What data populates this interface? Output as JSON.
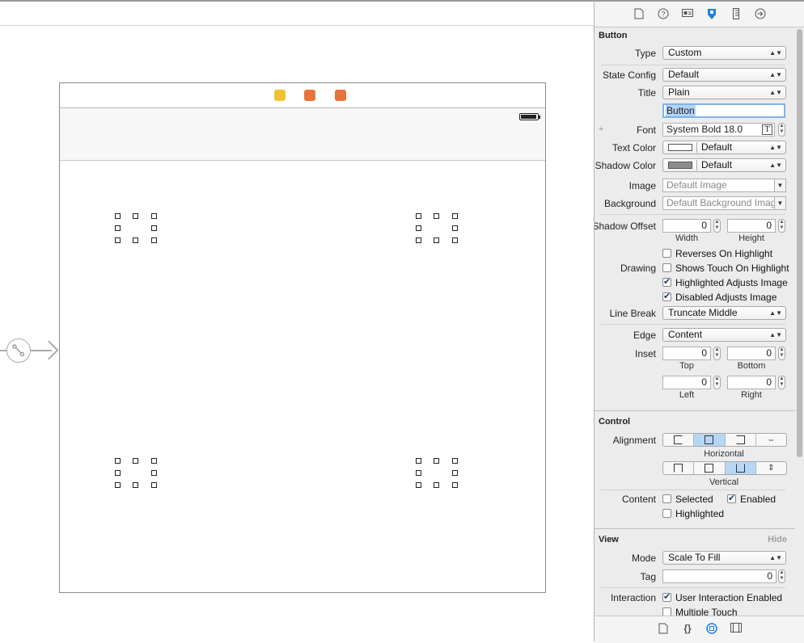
{
  "inspector": {
    "tabs": [
      "file-icon",
      "help-icon",
      "identity-icon",
      "attributes-icon",
      "ruler-icon",
      "connections-icon"
    ],
    "button_section": "Button",
    "type": {
      "label": "Type",
      "value": "Custom"
    },
    "state_config": {
      "label": "State Config",
      "value": "Default"
    },
    "title": {
      "label": "Title",
      "value": "Plain"
    },
    "title_text": "Button",
    "font": {
      "plus": "+",
      "label": "Font",
      "value": "System Bold 18.0"
    },
    "text_color": {
      "label": "Text Color",
      "value": "Default",
      "swatch": "#ffffff"
    },
    "shadow_color": {
      "label": "Shadow Color",
      "value": "Default",
      "swatch": "#8c8c8c"
    },
    "image": {
      "label": "Image",
      "placeholder": "Default Image"
    },
    "background": {
      "label": "Background",
      "placeholder": "Default Background Imag"
    },
    "shadow_offset": {
      "label": "Shadow Offset",
      "width": "0",
      "height": "0",
      "width_label": "Width",
      "height_label": "Height"
    },
    "drawing": {
      "label": "Drawing",
      "options": [
        {
          "label": "Reverses On Highlight",
          "checked": false
        },
        {
          "label": "Shows Touch On Highlight",
          "checked": false
        },
        {
          "label": "Highlighted Adjusts Image",
          "checked": true
        },
        {
          "label": "Disabled Adjusts Image",
          "checked": true
        }
      ]
    },
    "line_break": {
      "label": "Line Break",
      "value": "Truncate Middle"
    },
    "edge": {
      "label": "Edge",
      "value": "Content"
    },
    "inset": {
      "label": "Inset",
      "top": "0",
      "bottom": "0",
      "left": "0",
      "right": "0",
      "top_label": "Top",
      "bottom_label": "Bottom",
      "left_label": "Left",
      "right_label": "Right"
    },
    "control_section": "Control",
    "alignment": {
      "label": "Alignment",
      "horizontal_label": "Horizontal",
      "vertical_label": "Vertical",
      "horizontal_selected": 1,
      "vertical_selected": 2
    },
    "content": {
      "label": "Content",
      "selected": "Selected",
      "selected_checked": false,
      "enabled": "Enabled",
      "enabled_checked": true,
      "highlighted": "Highlighted",
      "highlighted_checked": false
    },
    "view_section": "View",
    "hide": "Hide",
    "mode": {
      "label": "Mode",
      "value": "Scale To Fill"
    },
    "tag": {
      "label": "Tag",
      "value": "0"
    },
    "interaction": {
      "label": "Interaction",
      "user_interaction": "User Interaction Enabled",
      "user_interaction_checked": true,
      "multiple_touch": "Multiple Touch",
      "multiple_touch_checked": false
    },
    "bottom_tabs": [
      "file-template-icon",
      "code-snippet-icon",
      "object-library-icon",
      "media-library-icon"
    ]
  },
  "scene": {
    "dock_icons": [
      {
        "name": "view-controller-icon",
        "color": "#f2c230"
      },
      {
        "name": "first-responder-icon",
        "color": "#e8733a"
      },
      {
        "name": "exit-icon",
        "color": "#e8733a"
      }
    ]
  }
}
